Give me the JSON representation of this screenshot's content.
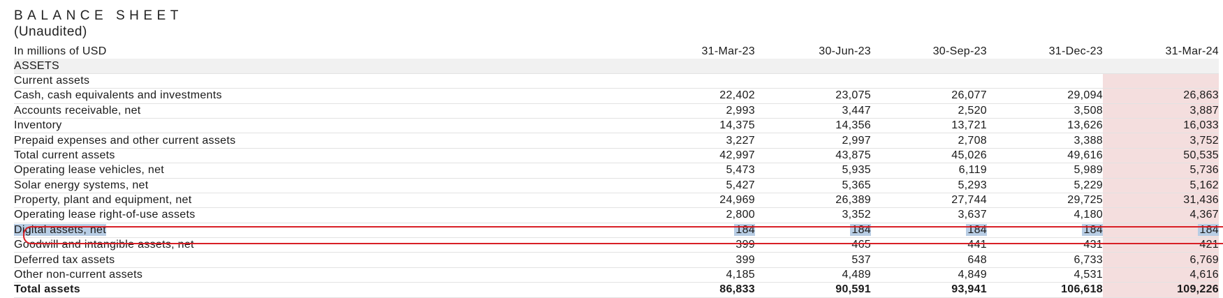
{
  "header": {
    "title": "BALANCE SHEET",
    "subtitle": "(Unaudited)"
  },
  "table": {
    "unit_label": "In millions of USD",
    "columns": [
      "31-Mar-23",
      "30-Jun-23",
      "30-Sep-23",
      "31-Dec-23",
      "31-Mar-24"
    ],
    "highlight_color": "#f4dede",
    "rows": [
      {
        "label": "ASSETS",
        "values": [
          "",
          "",
          "",
          "",
          ""
        ],
        "style": "section",
        "indent": 0
      },
      {
        "label": "Current assets",
        "values": [
          "",
          "",
          "",
          "",
          ""
        ],
        "style": "normal",
        "indent": 0
      },
      {
        "label": "Cash, cash equivalents and investments",
        "values": [
          "22,402",
          "23,075",
          "26,077",
          "29,094",
          "26,863"
        ],
        "style": "normal",
        "indent": 1
      },
      {
        "label": "Accounts receivable, net",
        "values": [
          "2,993",
          "3,447",
          "2,520",
          "3,508",
          "3,887"
        ],
        "style": "normal",
        "indent": 1
      },
      {
        "label": "Inventory",
        "values": [
          "14,375",
          "14,356",
          "13,721",
          "13,626",
          "16,033"
        ],
        "style": "normal",
        "indent": 1
      },
      {
        "label": "Prepaid expenses and other current assets",
        "values": [
          "3,227",
          "2,997",
          "2,708",
          "3,388",
          "3,752"
        ],
        "style": "normal",
        "indent": 1
      },
      {
        "label": "Total current assets",
        "values": [
          "42,997",
          "43,875",
          "45,026",
          "49,616",
          "50,535"
        ],
        "style": "normal",
        "indent": 2
      },
      {
        "label": "Operating lease vehicles, net",
        "values": [
          "5,473",
          "5,935",
          "6,119",
          "5,989",
          "5,736"
        ],
        "style": "normal",
        "indent": 0
      },
      {
        "label": "Solar energy systems, net",
        "values": [
          "5,427",
          "5,365",
          "5,293",
          "5,229",
          "5,162"
        ],
        "style": "normal",
        "indent": 0
      },
      {
        "label": "Property, plant and equipment, net",
        "values": [
          "24,969",
          "26,389",
          "27,744",
          "29,725",
          "31,436"
        ],
        "style": "normal",
        "indent": 0
      },
      {
        "label": "Operating lease right-of-use assets",
        "values": [
          "2,800",
          "3,352",
          "3,637",
          "4,180",
          "4,367"
        ],
        "style": "normal",
        "indent": 0
      },
      {
        "label": "Digital assets, net",
        "values": [
          "184",
          "184",
          "184",
          "184",
          "184"
        ],
        "style": "selected",
        "indent": 0
      },
      {
        "label": "Goodwill and intangible assets, net",
        "values": [
          "399",
          "465",
          "441",
          "431",
          "421"
        ],
        "style": "normal",
        "indent": 0
      },
      {
        "label": "Deferred tax assets",
        "values": [
          "399",
          "537",
          "648",
          "6,733",
          "6,769"
        ],
        "style": "normal",
        "indent": 0
      },
      {
        "label": "Other non-current assets",
        "values": [
          "4,185",
          "4,489",
          "4,849",
          "4,531",
          "4,616"
        ],
        "style": "normal",
        "indent": 0
      },
      {
        "label": "Total assets",
        "values": [
          "86,833",
          "90,591",
          "93,941",
          "106,618",
          "109,226"
        ],
        "style": "bold",
        "indent": 3
      }
    ]
  }
}
